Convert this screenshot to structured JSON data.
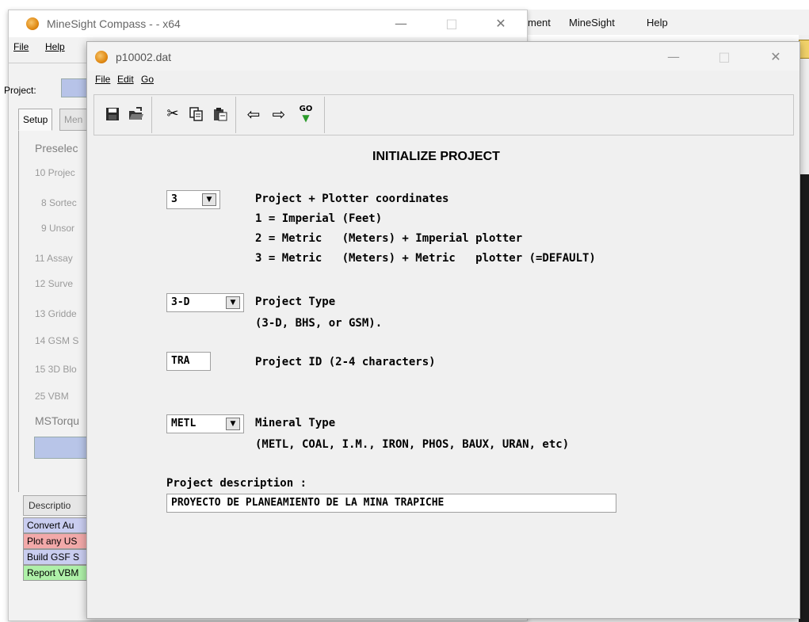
{
  "background_app": {
    "menu": [
      "ment",
      "MineSight",
      "Help"
    ]
  },
  "compass": {
    "title": "MineSight Compass -  - x64",
    "menu": [
      "File",
      "Help"
    ],
    "project_label": "Project:",
    "tabs": [
      "Setup",
      "Men"
    ],
    "items": [
      "Preselec",
      "10 Projec",
      "8 Sortec",
      "9 Unsor",
      "11 Assay",
      "12 Surve",
      "13 Gridde",
      "14 GSM S",
      "15 3D Blo",
      "25 VBM",
      "MSTorqu"
    ],
    "description_tab": "Descriptio",
    "descriptions": [
      {
        "text": "Convert Au",
        "color": "#c9cdf0"
      },
      {
        "text": "Plot any US",
        "color": "#f2a9a9"
      },
      {
        "text": "Build GSF S",
        "color": "#c9cdf0"
      },
      {
        "text": "Report VBM",
        "color": "#aef0a8"
      }
    ]
  },
  "dat_window": {
    "title": "p10002.dat",
    "menu": [
      "File",
      "Edit",
      "Go"
    ],
    "toolbar_icons": [
      "save-icon",
      "open-icon",
      "cut-icon",
      "copy-icon",
      "paste-icon",
      "back-arrow-icon",
      "forward-arrow-icon",
      "go-icon"
    ],
    "go_label": "GO",
    "heading": "INITIALIZE PROJECT",
    "coordinates": {
      "value": "3",
      "label": "Project + Plotter coordinates",
      "options": [
        "1 = Imperial (Feet)",
        "2 = Metric   (Meters) + Imperial plotter",
        "3 = Metric   (Meters) + Metric   plotter (=DEFAULT)"
      ]
    },
    "project_type": {
      "value": "3-D",
      "label": "Project Type",
      "help": "(3-D, BHS, or GSM)."
    },
    "project_id": {
      "value": "TRA",
      "label": "Project ID (2-4 characters)"
    },
    "mineral_type": {
      "value": "METL",
      "label": "Mineral Type",
      "help": "(METL, COAL, I.M., IRON, PHOS, BAUX, URAN, etc)"
    },
    "description": {
      "label": "Project description :",
      "value": "PROYECTO DE PLANEAMIENTO DE LA MINA TRAPICHE"
    }
  }
}
